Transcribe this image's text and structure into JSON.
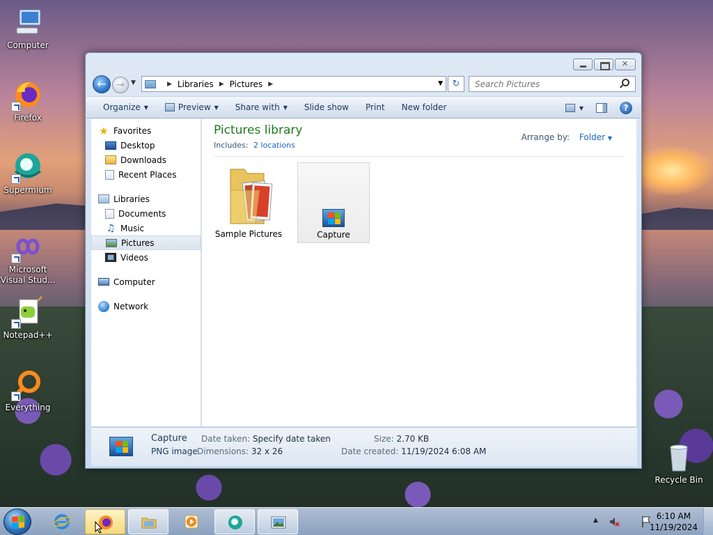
{
  "desktop": {
    "icons": [
      {
        "label": "Computer"
      },
      {
        "label": "Firefox"
      },
      {
        "label": "Supermium"
      },
      {
        "label": "Microsoft Visual Stud..."
      },
      {
        "label": "Notepad++"
      },
      {
        "label": "Everything"
      },
      {
        "label": "Recycle Bin"
      }
    ]
  },
  "window": {
    "address": {
      "crumbs": [
        "Libraries",
        "Pictures"
      ],
      "search_placeholder": "Search Pictures"
    },
    "toolbar": {
      "organize": "Organize",
      "preview": "Preview",
      "share_with": "Share with",
      "slide_show": "Slide show",
      "print": "Print",
      "new_folder": "New folder"
    },
    "nav": {
      "favorites": "Favorites",
      "desktop": "Desktop",
      "downloads": "Downloads",
      "recent_places": "Recent Places",
      "libraries": "Libraries",
      "documents": "Documents",
      "music": "Music",
      "pictures": "Pictures",
      "videos": "Videos",
      "computer": "Computer",
      "network": "Network"
    },
    "library": {
      "title": "Pictures library",
      "includes_label": "Includes:",
      "includes_link": "2 locations",
      "arrange_label": "Arrange by:",
      "arrange_value": "Folder"
    },
    "items": [
      {
        "label": "Sample Pictures"
      },
      {
        "label": "Capture"
      }
    ],
    "details": {
      "name": "Capture",
      "type": "PNG image",
      "date_taken_label": "Date taken:",
      "date_taken_value": "Specify date taken",
      "dimensions_label": "Dimensions:",
      "dimensions_value": "32 x 26",
      "size_label": "Size:",
      "size_value": "2.70 KB",
      "date_created_label": "Date created:",
      "date_created_value": "11/19/2024 6:08 AM"
    }
  },
  "taskbar": {
    "time": "6:10 AM",
    "date": "11/19/2024"
  },
  "colors": {
    "library_title": "#1e7a1e",
    "link": "#1a66c6"
  }
}
